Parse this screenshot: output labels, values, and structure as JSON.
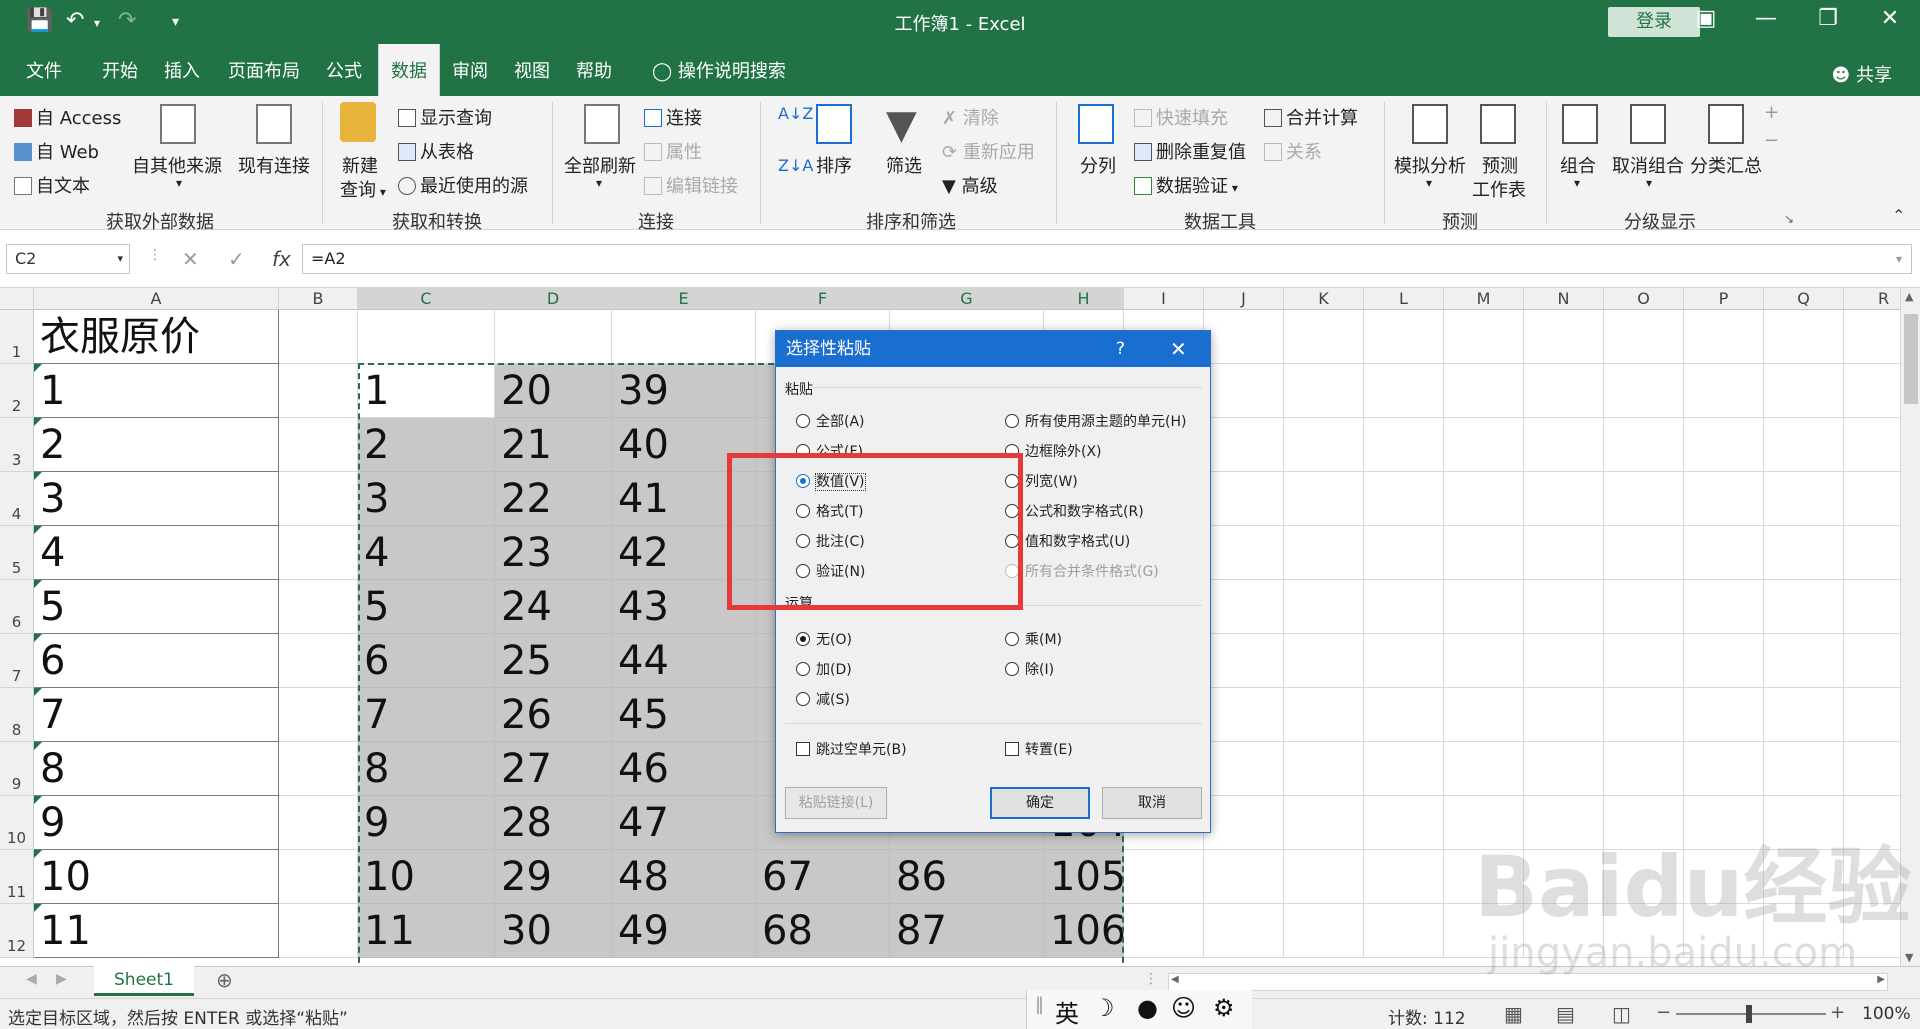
{
  "title_bar": {
    "title": "工作簿1 - Excel",
    "login": "登录"
  },
  "ribbon_tabs": [
    "文件",
    "开始",
    "插入",
    "页面布局",
    "公式",
    "数据",
    "审阅",
    "视图",
    "帮助"
  ],
  "active_tab": "数据",
  "tell_me": "操作说明搜索",
  "share": "共享",
  "ribbon": {
    "get_external": {
      "access": "自 Access",
      "web": "自 Web",
      "text": "自文本",
      "other": "自其他来源",
      "existing": "现有连接",
      "group": "获取外部数据"
    },
    "transform": {
      "new_query_1": "新建",
      "new_query_2": "查询",
      "show_queries": "显示查询",
      "from_table": "从表格",
      "recent": "最近使用的源",
      "group": "获取和转换"
    },
    "connections": {
      "refresh_all": "全部刷新",
      "connections": "连接",
      "properties": "属性",
      "edit_links": "编辑链接",
      "group": "连接"
    },
    "sort_filter": {
      "sort": "排序",
      "filter": "筛选",
      "clear": "清除",
      "reapply": "重新应用",
      "advanced": "高级",
      "group": "排序和筛选"
    },
    "data_tools": {
      "text_to_columns": "分列",
      "flash_fill": "快速填充",
      "remove_dup": "删除重复值",
      "validation": "数据验证",
      "consolidate": "合并计算",
      "relations": "关系",
      "group": "数据工具"
    },
    "forecast": {
      "what_if": "模拟分析",
      "sheet_1": "预测",
      "sheet_2": "工作表",
      "group": "预测"
    },
    "outline": {
      "group_btn": "组合",
      "ungroup": "取消组合",
      "subtotal": "分类汇总",
      "group": "分级显示"
    }
  },
  "formula_bar": {
    "name_box": "C2",
    "formula": "=A2"
  },
  "columns": [
    "A",
    "B",
    "C",
    "D",
    "E",
    "F",
    "G",
    "H",
    "I",
    "J",
    "K",
    "L",
    "M",
    "N",
    "O",
    "P",
    "Q",
    "R"
  ],
  "rows": [
    "1",
    "2",
    "3",
    "4",
    "5",
    "6",
    "7",
    "8",
    "9",
    "10",
    "11",
    "12"
  ],
  "sheet": {
    "A1": "衣服原价",
    "col_A": [
      "1",
      "2",
      "3",
      "4",
      "5",
      "6",
      "7",
      "8",
      "9",
      "10",
      "11"
    ],
    "col_C": [
      "1",
      "2",
      "3",
      "4",
      "5",
      "6",
      "7",
      "8",
      "9",
      "10",
      "11"
    ],
    "col_D": [
      "20",
      "21",
      "22",
      "23",
      "24",
      "25",
      "26",
      "27",
      "28",
      "29",
      "30"
    ],
    "col_E": [
      "39",
      "40",
      "41",
      "42",
      "43",
      "44",
      "45",
      "46",
      "47",
      "48",
      "49"
    ],
    "col_F": [
      "67",
      "68"
    ],
    "col_G": [
      "86",
      "87"
    ],
    "col_H": [
      "104",
      "105",
      "106"
    ]
  },
  "dialog": {
    "title": "选择性粘贴",
    "help": "?",
    "close": "✕",
    "paste_section": "粘贴",
    "paste_left": [
      "全部(A)",
      "公式(F)",
      "数值(V)",
      "格式(T)",
      "批注(C)",
      "验证(N)"
    ],
    "paste_right": [
      "所有使用源主题的单元(H)",
      "边框除外(X)",
      "列宽(W)",
      "公式和数字格式(R)",
      "值和数字格式(U)",
      "所有合并条件格式(G)"
    ],
    "op_section": "运算",
    "op_left": [
      "无(O)",
      "加(D)",
      "减(S)"
    ],
    "op_right": [
      "乘(M)",
      "除(I)"
    ],
    "skip_blanks": "跳过空单元(B)",
    "transpose": "转置(E)",
    "paste_link": "粘贴链接(L)",
    "ok": "确定",
    "cancel": "取消"
  },
  "sheet_tab": "Sheet1",
  "status": {
    "message": "选定目标区域，然后按 ENTER 或选择“粘贴”",
    "count": "计数: 112",
    "zoom": "100%"
  },
  "ime": {
    "lang": "英"
  },
  "watermark": {
    "logo": "Baidu经验",
    "url": "jingyan.baidu.com"
  },
  "colors": {
    "excel_green": "#217346",
    "dialog_blue": "#1a6ecf",
    "highlight_red": "#e63a3a"
  }
}
